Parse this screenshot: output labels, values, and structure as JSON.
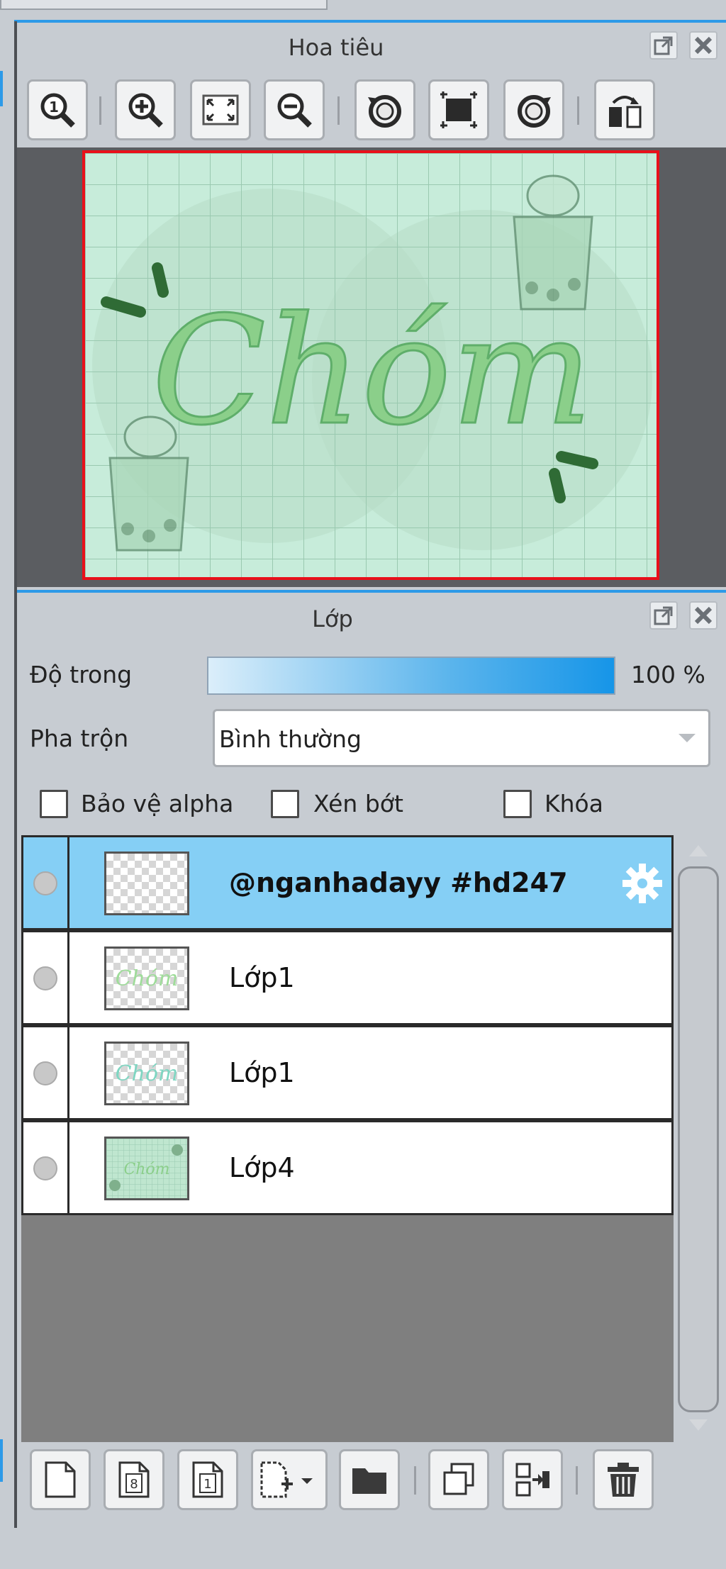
{
  "navigator": {
    "title": "Hoa tiêu",
    "toolbar_icons": [
      "actual-size-icon",
      "zoom-in-icon",
      "fit-screen-icon",
      "zoom-out-icon",
      "rotate-left-icon",
      "reset-rotation-icon",
      "rotate-right-icon",
      "flip-horizontal-icon"
    ],
    "preview_text": "Chóm"
  },
  "layers_panel": {
    "title": "Lớp",
    "opacity_label": "Độ trong",
    "opacity_value": "100 %",
    "opacity_fraction": 1.0,
    "blend_label": "Pha trộn",
    "blend_value": "Bình thường",
    "checkboxes": [
      {
        "label": "Bảo vệ alpha",
        "checked": false
      },
      {
        "label": "Xén bớt",
        "checked": false
      },
      {
        "label": "Khóa",
        "checked": false
      }
    ],
    "layers": [
      {
        "name": "@nganhadayy #hd247",
        "selected": true
      },
      {
        "name": "Lớp1",
        "selected": false
      },
      {
        "name": "Lớp1",
        "selected": false
      },
      {
        "name": "Lớp4",
        "selected": false
      }
    ],
    "bottom_icons": [
      "new-layer-icon",
      "new-8bit-layer-icon",
      "new-1bit-layer-icon",
      "add-layer-dropdown-icon",
      "new-folder-icon",
      "duplicate-layer-icon",
      "merge-down-icon",
      "delete-layer-icon"
    ]
  },
  "colors": {
    "accent": "#2d9ae8",
    "selected_row": "#85cff5",
    "canvas_border": "#e8101a",
    "canvas_bg": "#c7ecda"
  }
}
